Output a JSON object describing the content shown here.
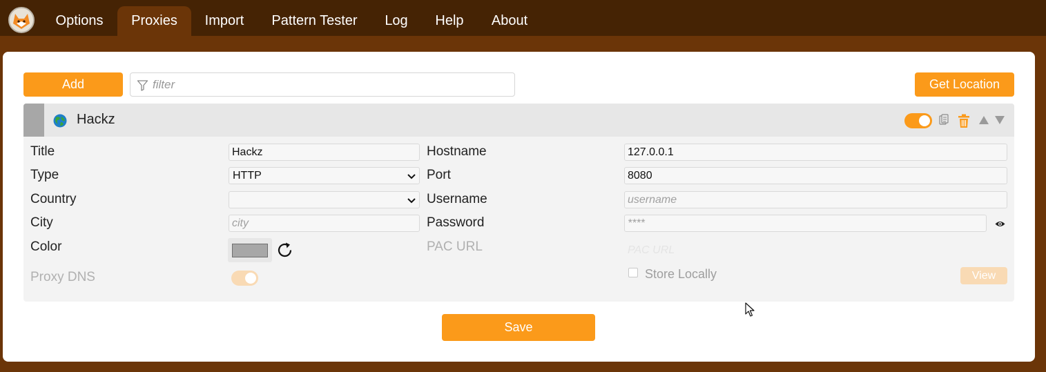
{
  "nav": {
    "tabs": [
      {
        "label": "Options"
      },
      {
        "label": "Proxies"
      },
      {
        "label": "Import"
      },
      {
        "label": "Pattern Tester"
      },
      {
        "label": "Log"
      },
      {
        "label": "Help"
      },
      {
        "label": "About"
      }
    ],
    "active_tab": "Proxies"
  },
  "toolbar": {
    "add_label": "Add",
    "filter_placeholder": "filter",
    "get_location_label": "Get Location"
  },
  "proxy": {
    "title": "Hackz",
    "enabled": true,
    "fields": {
      "title_label": "Title",
      "title_value": "Hackz",
      "type_label": "Type",
      "type_value": "HTTP",
      "country_label": "Country",
      "country_value": "",
      "city_label": "City",
      "city_placeholder": "city",
      "color_label": "Color",
      "color_value": "#a7a7a7",
      "proxy_dns_label": "Proxy DNS",
      "hostname_label": "Hostname",
      "hostname_value": "127.0.0.1",
      "port_label": "Port",
      "port_value": "8080",
      "username_label": "Username",
      "username_placeholder": "username",
      "password_label": "Password",
      "password_placeholder": "****",
      "pac_url_label": "PAC URL",
      "pac_url_placeholder": "PAC URL",
      "store_locally_label": "Store Locally",
      "view_label": "View"
    }
  },
  "footer": {
    "save_label": "Save"
  },
  "colors": {
    "accent": "#fb9a1a",
    "nav_bg": "#452304",
    "page_bg": "#6b3508",
    "proxy_color": "#a7a7a7"
  },
  "icons": [
    "foxyproxy-logo",
    "filter-icon",
    "globe-icon",
    "duplicate-icon",
    "trash-icon",
    "move-up-icon",
    "move-down-icon",
    "refresh-icon",
    "eye-icon",
    "chevron-down-icon"
  ]
}
